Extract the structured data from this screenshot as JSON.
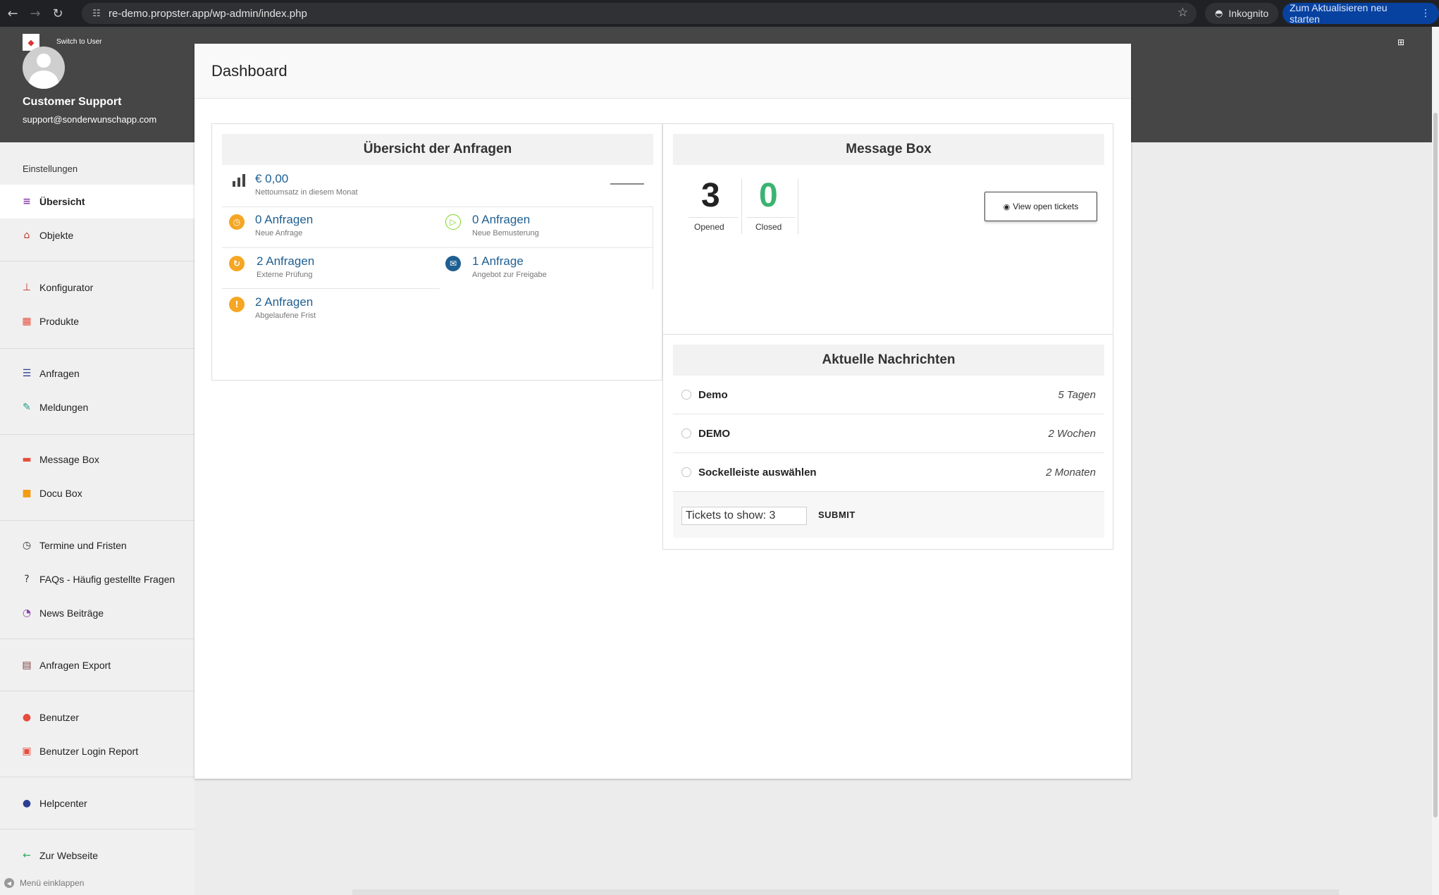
{
  "browser": {
    "url": "re-demo.propster.app/wp-admin/index.php",
    "incognito_label": "Inkognito",
    "relaunch_label": "Zum Aktualisieren neu starten"
  },
  "user": {
    "switch_label": "Switch to User",
    "name": "Customer Support",
    "email": "support@sonderwunschapp.com"
  },
  "sidebar": {
    "section_label": "Einstellungen",
    "items": [
      {
        "label": "Übersicht",
        "icon": "list-icon",
        "color": "#8e44ad"
      },
      {
        "label": "Objekte",
        "icon": "home-icon",
        "color": "#c0392b"
      },
      {
        "label": "Konfigurator",
        "icon": "sitemap-icon",
        "color": "#c0392b"
      },
      {
        "label": "Produkte",
        "icon": "grid-icon",
        "color": "#e74c3c"
      },
      {
        "label": "Anfragen",
        "icon": "table-icon",
        "color": "#2c3e90"
      },
      {
        "label": "Meldungen",
        "icon": "edit-icon",
        "color": "#16a085"
      },
      {
        "label": "Message Box",
        "icon": "chat-icon",
        "color": "#e74c3c"
      },
      {
        "label": "Docu Box",
        "icon": "folder-icon",
        "color": "#f39c12"
      },
      {
        "label": "Termine und Fristen",
        "icon": "clock-icon",
        "color": "#333333"
      },
      {
        "label": "FAQs - Häufig gestellte Fragen",
        "icon": "question-icon",
        "color": "#333333"
      },
      {
        "label": "News Beiträge",
        "icon": "rss-icon",
        "color": "#8e44ad"
      },
      {
        "label": "Anfragen Export",
        "icon": "document-icon",
        "color": "#7b3f3f"
      },
      {
        "label": "Benutzer",
        "icon": "user-icon",
        "color": "#e74c3c"
      },
      {
        "label": "Benutzer Login Report",
        "icon": "report-icon",
        "color": "#e74c3c"
      },
      {
        "label": "Helpcenter",
        "icon": "help-icon",
        "color": "#2c3e90"
      },
      {
        "label": "Zur Webseite",
        "icon": "arrow-left-icon",
        "color": "#27ae60"
      }
    ],
    "collapse_label": "Menü einklappen"
  },
  "page": {
    "title": "Dashboard"
  },
  "overview": {
    "title": "Übersicht der Anfragen",
    "revenue": {
      "value": "€ 0,00",
      "label": "Nettoumsatz in diesem Monat"
    },
    "stats": [
      {
        "value": "0 Anfragen",
        "label": "Neue Anfrage",
        "icon": "clock-icon",
        "color": "#f5a623"
      },
      {
        "value": "0 Anfragen",
        "label": "Neue Bemusterung",
        "icon": "play-icon",
        "color": "#7ed321"
      },
      {
        "value": "2 Anfragen",
        "label": "Externe Prüfung",
        "icon": "refresh-icon",
        "color": "#f5a623"
      },
      {
        "value": "1 Anfrage",
        "label": "Angebot zur Freigabe",
        "icon": "mail-icon",
        "color": "#1f5f91"
      },
      {
        "value": "2 Anfragen",
        "label": "Abgelaufene Frist",
        "icon": "warning-icon",
        "color": "#f5a623"
      }
    ]
  },
  "message_box": {
    "title": "Message Box",
    "opened": "3",
    "opened_label": "Opened",
    "closed": "0",
    "closed_label": "Closed",
    "closed_color": "#3cb371",
    "view_button": "View open tickets"
  },
  "news": {
    "title": "Aktuelle Nachrichten",
    "items": [
      {
        "title": "Demo",
        "time": "5 Tagen"
      },
      {
        "title": "DEMO",
        "time": "2 Wochen"
      },
      {
        "title": "Sockelleiste auswählen",
        "time": "2 Monaten"
      }
    ],
    "tickets_input_value": "Tickets to show: 3",
    "submit_label": "SUBMIT"
  }
}
